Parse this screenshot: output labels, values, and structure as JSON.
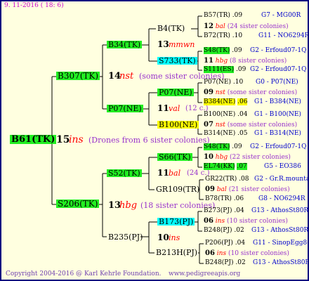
{
  "header": {
    "date": "9. 11-2016 ( 18: 6)"
  },
  "footer": {
    "copyright": "Copyright 2004-2016 @ Karl Kehrle Foundation.",
    "url": "www.pedigreeapis.org"
  },
  "root": {
    "name": "B61(TK)",
    "gen": "15",
    "mark": "ins",
    "note": "(Drones from 6 sister colonies)"
  },
  "level1": [
    {
      "name": "B307(TK)",
      "gen": "14",
      "mark": "nst",
      "note": "(some sister colonies)"
    },
    {
      "name": "S206(TK)",
      "gen": "13",
      "mark": "hbg",
      "note": "(18 sister colonies)"
    }
  ],
  "level2": [
    {
      "name": "B34(TK)",
      "gen": "13",
      "mark": "mmwn",
      "note": ""
    },
    {
      "name": "P07(NE)",
      "gen": "11",
      "mark": "val",
      "note": "(12 c.)"
    },
    {
      "name": "S52(TK)",
      "gen": "11",
      "mark": "bal",
      "note": "(24 c.)"
    },
    {
      "name": "B235(PJ)",
      "gen": "10",
      "mark": "ins",
      "note": ""
    }
  ],
  "level3": [
    {
      "name": "B4(TK)"
    },
    {
      "name": "S733(TK)"
    },
    {
      "name": "P07(NE)"
    },
    {
      "name": "B100(NE)"
    },
    {
      "name": "S66(TK)"
    },
    {
      "name": "GR109(TR)"
    },
    {
      "name": "B173(PJ)"
    },
    {
      "name": "B213H(PJ)"
    }
  ],
  "level4": [
    {
      "name": "B57(TR)",
      "num": ".09",
      "origin": "G7 - MG00R"
    },
    {
      "gen": "12",
      "mark": "bal",
      "note": "(24 sister colonies)"
    },
    {
      "name": "B72(TR)",
      "num": ".10",
      "origin": "G11 - NO6294R"
    },
    {
      "name": "S48(TK)",
      "num": ".09",
      "origin": "G2 - Erfoud07-1Q"
    },
    {
      "gen": "11",
      "mark": "hbg",
      "note": "(8 sister colonies)"
    },
    {
      "name": "S111(ES)",
      "num": ".09",
      "origin": "G2 - Erfoud07-1Q"
    },
    {
      "name": "P07(NE)",
      "num": ".10",
      "origin": "G0 - P07(NE)"
    },
    {
      "gen": "09",
      "mark": "nst",
      "note": "(some sister colonies)"
    },
    {
      "name": "B384(NE)",
      "num": ".06",
      "origin": "G1 - B384(NE)"
    },
    {
      "name": "B100(NE)",
      "num": ".04",
      "origin": "G1 - B100(NE)"
    },
    {
      "gen": "07",
      "mark": "nst",
      "note": "(some sister colonies)"
    },
    {
      "name": "B314(NE)",
      "num": ".05",
      "origin": "G1 - B314(NE)"
    },
    {
      "name": "S48(TK)",
      "num": ".09",
      "origin": "G2 - Erfoud07-1Q"
    },
    {
      "gen": "10",
      "mark": "hbg",
      "note": "(22 sister colonies)"
    },
    {
      "name": "EL74(KK)",
      "num": ".07",
      "origin": "G5 - EO386"
    },
    {
      "name": "GR22(TR)",
      "num": ".08",
      "origin": "G2 - Gr.R.mounta"
    },
    {
      "gen": "09",
      "mark": "bal",
      "note": "(21 sister colonies)"
    },
    {
      "name": "B78(TR)",
      "num": ".06",
      "origin": "G8 - NO6294R"
    },
    {
      "name": "B273(PJ)",
      "num": ".04",
      "origin": "G13 - AthosSt80R"
    },
    {
      "gen": "06",
      "mark": "ins",
      "note": "(10 sister colonies)"
    },
    {
      "name": "B248(PJ)",
      "num": ".02",
      "origin": "G13 - AthosSt80R"
    },
    {
      "name": "P206(PJ)",
      "num": ".04",
      "origin": "G11 - SinopEgg86R"
    },
    {
      "gen": "06",
      "mark": "ins",
      "note": "(10 sister colonies)"
    },
    {
      "name": "B248(PJ)",
      "num": ".02",
      "origin": "G13 - AthosSt80R"
    }
  ],
  "colors": {
    "highlight_green": "#22ee22",
    "highlight_yellow": "#ffff00",
    "highlight_cyan": "#00ffff",
    "line": "#000000",
    "footer": "#6f3fb0",
    "origin_text": "#0000cc"
  }
}
